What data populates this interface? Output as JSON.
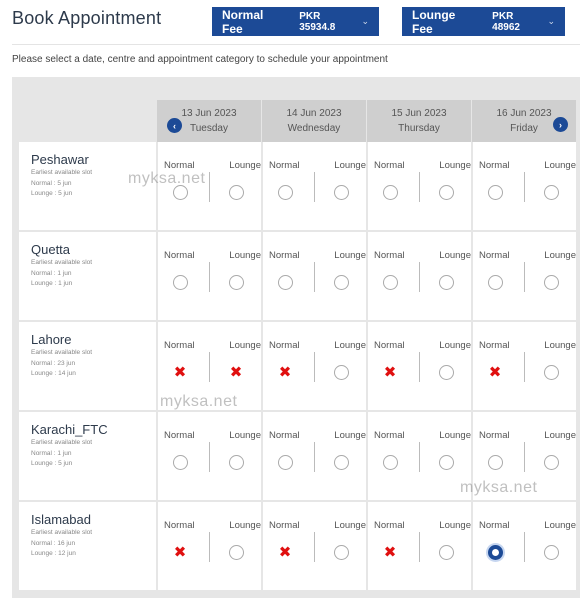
{
  "header": {
    "title": "Book Appointment",
    "normal_fee": {
      "label": "Normal Fee",
      "amount": "PKR 35934.8"
    },
    "lounge_fee": {
      "label": "Lounge Fee",
      "amount": "PKR 48962"
    }
  },
  "instructions": "Please select a date, centre and appointment category to schedule your appointment",
  "dates": [
    {
      "date": "13 Jun 2023",
      "day": "Tuesday"
    },
    {
      "date": "14 Jun 2023",
      "day": "Wednesday"
    },
    {
      "date": "15 Jun 2023",
      "day": "Thursday"
    },
    {
      "date": "16 Jun 2023",
      "day": "Friday"
    }
  ],
  "slot_labels": {
    "normal": "Normal",
    "lounge": "Lounge"
  },
  "icons": {
    "prev": "chevron-left-icon",
    "next": "chevron-right-icon",
    "dropdown": "chevron-down-icon",
    "unavailable": "cross-icon",
    "available": "radio-icon"
  },
  "colors": {
    "accent": "#1c4a96",
    "unavailable": "#e01010",
    "panel_bg": "#e6e6e6",
    "date_head_bg": "#cfcfcf"
  },
  "centres": [
    {
      "name": "Peshawar",
      "earliest_label": "Earliest available slot",
      "normal": "Normal : 5 jun",
      "lounge": "Lounge : 5 jun",
      "slots": [
        [
          "available",
          "available"
        ],
        [
          "available",
          "available"
        ],
        [
          "available",
          "available"
        ],
        [
          "available",
          "available"
        ]
      ]
    },
    {
      "name": "Quetta",
      "earliest_label": "Earliest available slot",
      "normal": "Normal : 1 jun",
      "lounge": "Lounge : 1 jun",
      "slots": [
        [
          "available",
          "available"
        ],
        [
          "available",
          "available"
        ],
        [
          "available",
          "available"
        ],
        [
          "available",
          "available"
        ]
      ]
    },
    {
      "name": "Lahore",
      "earliest_label": "Earliest available slot",
      "normal": "Normal : 23 jun",
      "lounge": "Lounge : 14 jun",
      "slots": [
        [
          "unavailable",
          "unavailable"
        ],
        [
          "unavailable",
          "available"
        ],
        [
          "unavailable",
          "available"
        ],
        [
          "unavailable",
          "available"
        ]
      ]
    },
    {
      "name": "Karachi_FTC",
      "earliest_label": "Earliest available slot",
      "normal": "Normal : 1 jun",
      "lounge": "Lounge : 5 jun",
      "slots": [
        [
          "available",
          "available"
        ],
        [
          "available",
          "available"
        ],
        [
          "available",
          "available"
        ],
        [
          "available",
          "available"
        ]
      ]
    },
    {
      "name": "Islamabad",
      "earliest_label": "Earliest available slot",
      "normal": "Normal : 16 jun",
      "lounge": "Lounge : 12 jun",
      "slots": [
        [
          "unavailable",
          "available"
        ],
        [
          "unavailable",
          "available"
        ],
        [
          "unavailable",
          "available"
        ],
        [
          "selected",
          "available"
        ]
      ]
    }
  ],
  "watermark": "myksa.net"
}
